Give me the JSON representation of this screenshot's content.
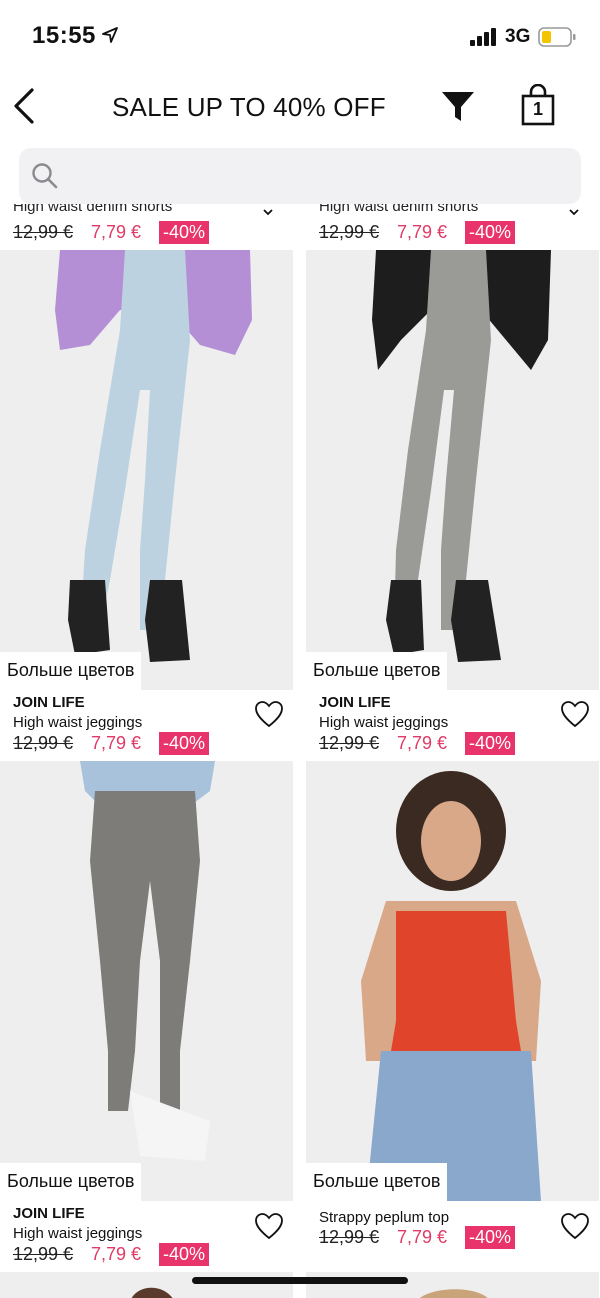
{
  "status_bar": {
    "time": "15:55",
    "network": "3G",
    "icons": [
      "location-arrow-icon",
      "signal-icon",
      "battery-icon"
    ]
  },
  "nav": {
    "title": "SALE UP TO 40% OFF",
    "bag_count": "1",
    "icons": [
      "back-icon",
      "filter-icon",
      "bag-icon"
    ]
  },
  "search": {
    "placeholder": ""
  },
  "more_colors_label": "Больше цветов",
  "top_partial": [
    {
      "name": "High waist denim shorts",
      "old_price": "12,99 €",
      "new_price": "7,79 €",
      "discount": "-40%"
    },
    {
      "name": "High waist denim shorts",
      "old_price": "12,99 €",
      "new_price": "7,79 €",
      "discount": "-40%"
    }
  ],
  "products": [
    {
      "brand": "JOIN LIFE",
      "name": "High waist jeggings",
      "old_price": "12,99 €",
      "new_price": "7,79 €",
      "discount": "-40%"
    },
    {
      "brand": "JOIN LIFE",
      "name": "High waist jeggings",
      "old_price": "12,99 €",
      "new_price": "7,79 €",
      "discount": "-40%"
    },
    {
      "brand": "JOIN LIFE",
      "name": "High waist jeggings",
      "old_price": "12,99 €",
      "new_price": "7,79 €",
      "discount": "-40%"
    },
    {
      "brand": "",
      "name": "Strappy peplum top",
      "old_price": "12,99 €",
      "new_price": "7,79 €",
      "discount": "-40%"
    }
  ],
  "colors": {
    "sale_red": "#e23a66",
    "badge_bg": "#e8336b",
    "search_bg": "#f1f1f3",
    "photo_bg": "#eeeeee"
  }
}
